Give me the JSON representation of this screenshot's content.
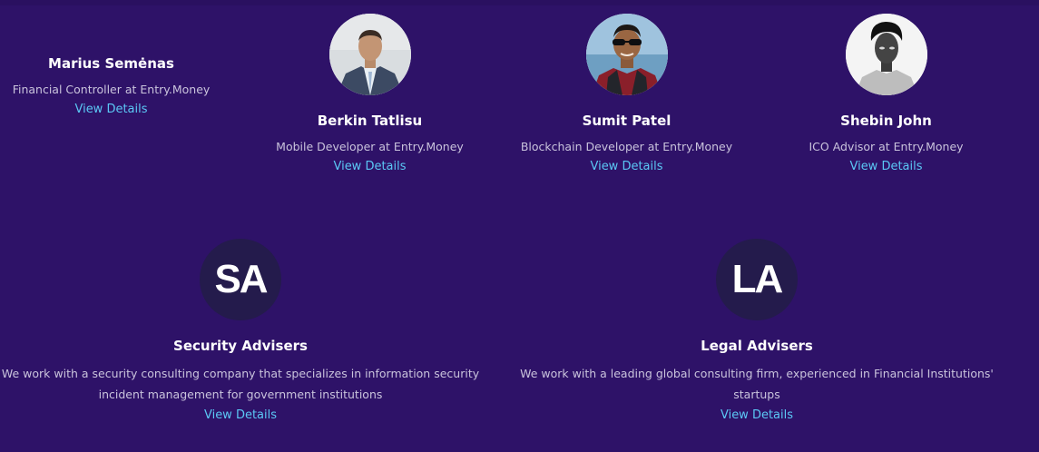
{
  "team": [
    {
      "name": "Marius Semėnas",
      "role": "Financial Controller at Entry.Money",
      "link": "View Details"
    },
    {
      "name": "Berkin Tatlisu",
      "role": "Mobile Developer at Entry.Money",
      "link": "View Details"
    },
    {
      "name": "Sumit Patel",
      "role": "Blockchain Developer at Entry.Money",
      "link": "View Details"
    },
    {
      "name": "Shebin John",
      "role": "ICO Advisor at Entry.Money",
      "link": "View Details"
    }
  ],
  "advisers": [
    {
      "initials": "SA",
      "title": "Security Advisers",
      "desc_line1": "We work with a security consulting company that specializes in information security",
      "desc_line2": "incident management for government institutions",
      "link": "View Details"
    },
    {
      "initials": "LA",
      "title": "Legal Advisers",
      "desc_line1": "We work with a leading global consulting firm, experienced in Financial Institutions'",
      "desc_line2": "startups",
      "link": "View Details"
    }
  ],
  "colors": {
    "background": "#2e1268",
    "link": "#5bc8f5",
    "initials_circle": "#241b4c"
  }
}
